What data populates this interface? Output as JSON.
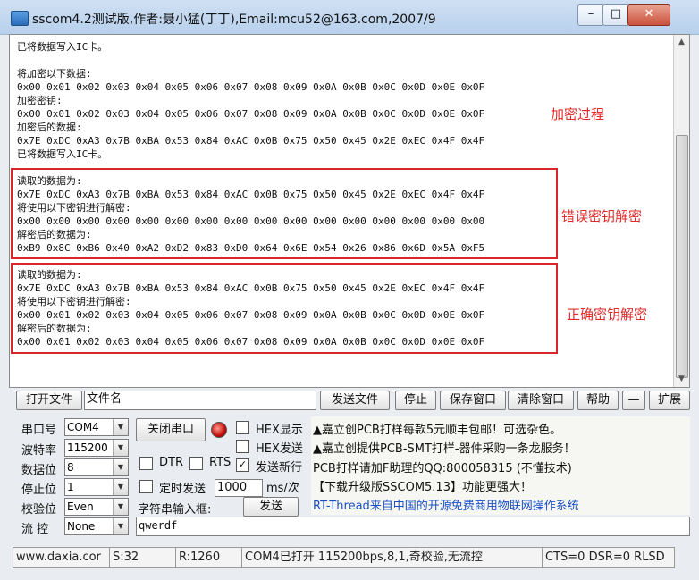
{
  "window": {
    "title": "sscom4.2测试版,作者:聂小猛(丁丁),Email:mcu52@163.com,2007/9",
    "min_icon": "minimize-icon",
    "max_icon": "maximize-icon",
    "close_icon": "close-icon",
    "min_glyph": "–",
    "max_glyph": "□",
    "close_glyph": "✕"
  },
  "output": {
    "lines": [
      "已将数据写入IC卡。",
      "",
      "将加密以下数据:",
      "0x00 0x01 0x02 0x03 0x04 0x05 0x06 0x07 0x08 0x09 0x0A 0x0B 0x0C 0x0D 0x0E 0x0F",
      "加密密钥:",
      "0x00 0x01 0x02 0x03 0x04 0x05 0x06 0x07 0x08 0x09 0x0A 0x0B 0x0C 0x0D 0x0E 0x0F",
      "加密后的数据:",
      "0x7E 0xDC 0xA3 0x7B 0xBA 0x53 0x84 0xAC 0x0B 0x75 0x50 0x45 0x2E 0xEC 0x4F 0x4F",
      "已将数据写入IC卡。",
      "",
      "读取的数据为:",
      "0x7E 0xDC 0xA3 0x7B 0xBA 0x53 0x84 0xAC 0x0B 0x75 0x50 0x45 0x2E 0xEC 0x4F 0x4F",
      "将使用以下密钥进行解密:",
      "0x00 0x00 0x00 0x00 0x00 0x00 0x00 0x00 0x00 0x00 0x00 0x00 0x00 0x00 0x00 0x00",
      "解密后的数据为:",
      "0xB9 0x8C 0xB6 0x40 0xA2 0xD2 0x83 0xD0 0x64 0x6E 0x54 0x26 0x86 0x6D 0x5A 0xF5",
      "",
      "读取的数据为:",
      "0x7E 0xDC 0xA3 0x7B 0xBA 0x53 0x84 0xAC 0x0B 0x75 0x50 0x45 0x2E 0xEC 0x4F 0x4F",
      "将使用以下密钥进行解密:",
      "0x00 0x01 0x02 0x03 0x04 0x05 0x06 0x07 0x08 0x09 0x0A 0x0B 0x0C 0x0D 0x0E 0x0F",
      "解密后的数据为:",
      "0x00 0x01 0x02 0x03 0x04 0x05 0x06 0x07 0x08 0x09 0x0A 0x0B 0x0C 0x0D 0x0E 0x0F"
    ]
  },
  "annotations": {
    "encrypt": "加密过程",
    "wrong_key": "错误密钥解密",
    "right_key": "正确密钥解密",
    "color": "#e02b2b"
  },
  "toolbar": {
    "open_file": "打开文件",
    "filename": "文件名",
    "send_file": "发送文件",
    "stop": "停止",
    "save_window": "保存窗口",
    "clear_window": "清除窗口",
    "help": "帮助",
    "dash": "—",
    "expand": "扩展"
  },
  "settings": {
    "port_label": "串口号",
    "port_value": "COM4",
    "baud_label": "波特率",
    "baud_value": "115200",
    "databits_label": "数据位",
    "databits_value": "8",
    "stopbits_label": "停止位",
    "stopbits_value": "1",
    "parity_label": "校验位",
    "parity_value": "Even",
    "flow_label": "流 控",
    "flow_value": "None",
    "close_port": "关闭串口",
    "hex_display": "HEX显示",
    "hex_send": "HEX发送",
    "send_newline": "发送新行",
    "dtr": "DTR",
    "rts": "RTS",
    "timed_send": "定时发送",
    "interval": "1000",
    "interval_unit": "ms/次",
    "input_label": "字符串输入框:",
    "send": "发送",
    "input_value": "qwerdf",
    "send_newline_checked": "✓"
  },
  "ads": {
    "lines": [
      "▲嘉立创PCB打样每款5元顺丰包邮！可选杂色。",
      "▲嘉立创提供PCB-SMT打样-器件采购一条龙服务！",
      "PCB打样请加F助理的QQ:800058315 (不懂技术)",
      "【下载升级版SSCOM5.13】功能更强大！",
      "RT-Thread来自中国的开源免费商用物联网操作系统"
    ]
  },
  "status": {
    "site": "www.daxia.cor",
    "sent": "S:32",
    "received": "R:1260",
    "port_state": "COM4已打开  115200bps,8,1,奇校验,无流控",
    "lines": "CTS=0 DSR=0 RLSD"
  }
}
